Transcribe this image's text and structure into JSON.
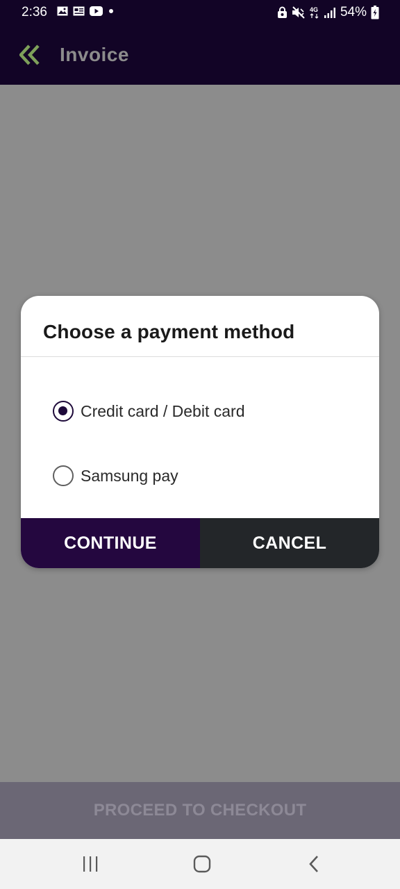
{
  "status_bar": {
    "time": "2:36",
    "battery": "54%",
    "network": "4G",
    "left_icons": [
      "gallery-icon",
      "news-icon",
      "youtube-icon",
      "dot-icon"
    ],
    "right_icons": [
      "lock-icon",
      "mute-icon",
      "network-4g-icon",
      "signal-icon",
      "battery-icon"
    ]
  },
  "app_bar": {
    "title": "Invoice",
    "back_icon": "double-chevron-left-icon",
    "back_icon_color": "#7ea05a",
    "background": "#120426"
  },
  "dialog": {
    "title": "Choose a payment method",
    "options": [
      {
        "label": "Credit card / Debit card",
        "selected": true
      },
      {
        "label": "Samsung pay",
        "selected": false
      }
    ],
    "continue_label": "CONTINUE",
    "cancel_label": "CANCEL",
    "continue_color": "#24073f",
    "cancel_color": "#232629"
  },
  "checkout": {
    "label": "PROCEED TO CHECKOUT"
  },
  "nav_bar": {
    "icons": [
      "recent-apps-icon",
      "home-icon",
      "back-icon"
    ]
  }
}
